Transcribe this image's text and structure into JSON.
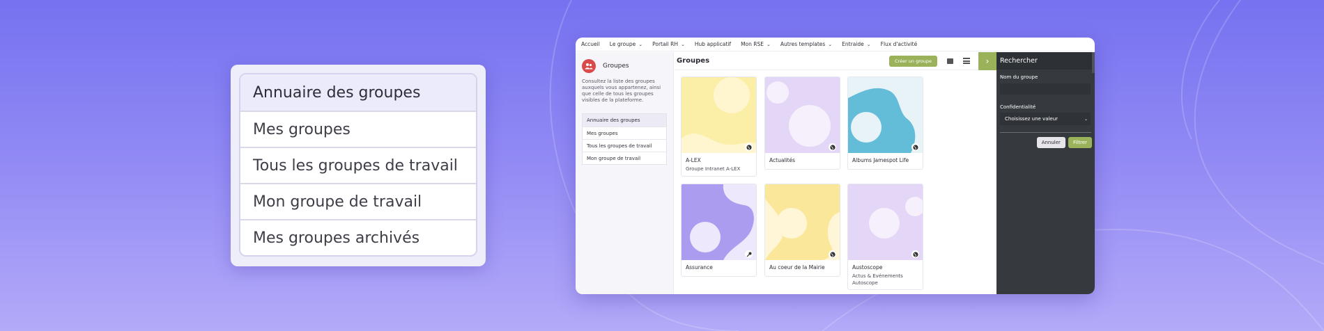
{
  "zoom": {
    "items": [
      {
        "label": "Annuaire des groupes"
      },
      {
        "label": "Mes groupes"
      },
      {
        "label": "Tous les groupes de travail"
      },
      {
        "label": "Mon groupe de travail"
      },
      {
        "label": "Mes groupes archivés"
      }
    ]
  },
  "nav": {
    "items": [
      {
        "label": "Accueil",
        "dropdown": false
      },
      {
        "label": "Le groupe",
        "dropdown": true
      },
      {
        "label": "Portail RH",
        "dropdown": true
      },
      {
        "label": "Hub applicatif",
        "dropdown": false
      },
      {
        "label": "Mon RSE",
        "dropdown": true
      },
      {
        "label": "Autres templates",
        "dropdown": true
      },
      {
        "label": "Entraide",
        "dropdown": true
      },
      {
        "label": "Flux d'activité",
        "dropdown": false
      }
    ]
  },
  "sidebar": {
    "title": "Groupes",
    "description": "Consultez la liste des groupes auxquels vous appartenez, ainsi que celle de tous les groupes visibles de la plateforme.",
    "items": [
      {
        "label": "Annuaire des groupes"
      },
      {
        "label": "Mes groupes"
      },
      {
        "label": "Tous les groupes de travail"
      },
      {
        "label": "Mon groupe de travail"
      }
    ]
  },
  "main": {
    "title": "Groupes",
    "create_label": "Créer un groupe",
    "cards": [
      {
        "title": "A-LEX",
        "subtitle": "Groupe Intranet A-LEX",
        "bg": "#fbeea6",
        "blob": "#fff6cf",
        "badge": "globe-icon"
      },
      {
        "title": "Actualités",
        "subtitle": "",
        "bg": "#e4d6f7",
        "blob": "#f6f0fc",
        "badge": "globe-icon"
      },
      {
        "title": "Albums Jamespot Life",
        "subtitle": "",
        "bg": "#e8f3f8",
        "blob": "#63bcd8",
        "badge": "globe-icon"
      },
      {
        "title": "Assurance",
        "subtitle": "",
        "bg": "#ede8fb",
        "blob": "#ab9cf0",
        "badge": "key-icon"
      },
      {
        "title": "Au coeur de la Mairie",
        "subtitle": "",
        "bg": "#fff6d8",
        "blob": "#fbe79a",
        "badge": "globe-icon"
      },
      {
        "title": "Austoscope",
        "subtitle": "Actus & Evénements Autoscope",
        "bg": "#e4d6f7",
        "blob": "#f6f0fc",
        "badge": "globe-icon"
      }
    ]
  },
  "panel": {
    "title": "Rechercher",
    "name_label": "Nom du groupe",
    "name_value": "",
    "conf_label": "Confidentialité",
    "conf_value": "Choisissez une valeur",
    "cancel_label": "Annuler",
    "filter_label": "Filtrer"
  },
  "colors": {
    "accent": "#9ab35a",
    "panel_bg": "#363a3f",
    "avatar": "#d94a4a"
  }
}
